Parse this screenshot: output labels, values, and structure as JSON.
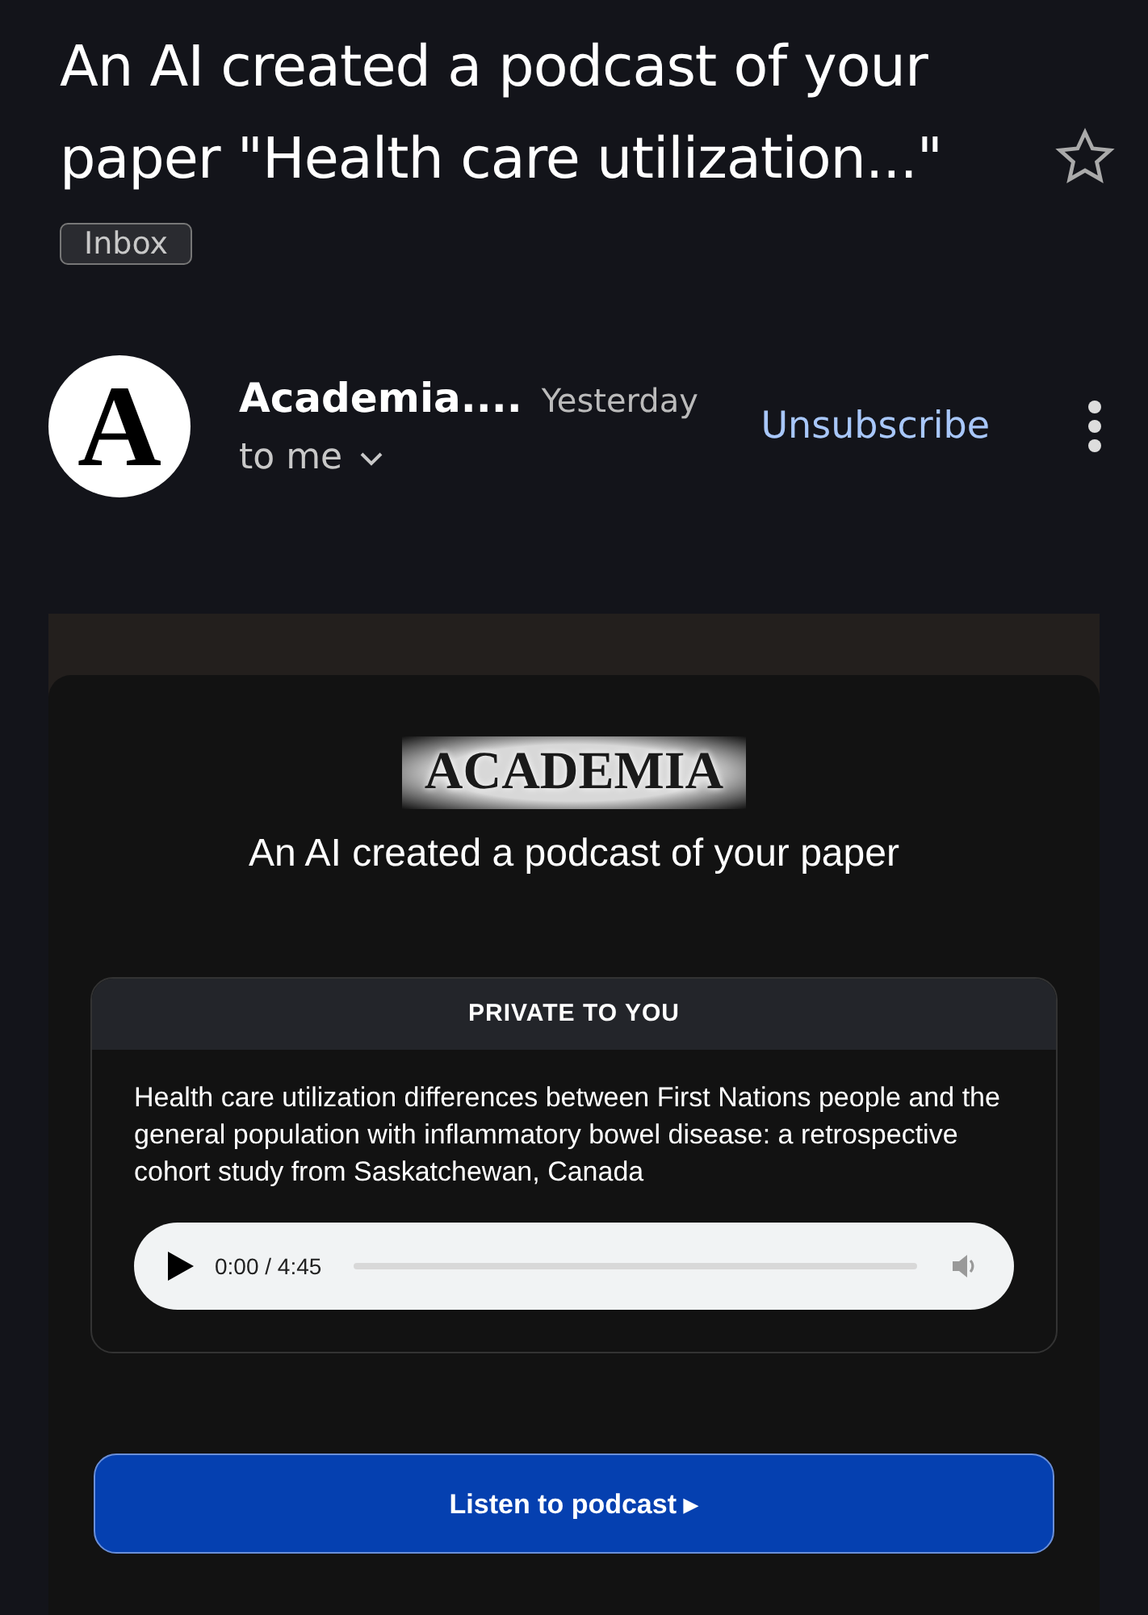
{
  "subject": {
    "title": "An AI created a podcast of your paper \"Health care utilization...\"",
    "starred": false,
    "label": "Inbox"
  },
  "sender": {
    "avatar_letter": "A",
    "name": "Academia....",
    "time": "Yesterday",
    "recipient": "to me",
    "unsubscribe": "Unsubscribe"
  },
  "body": {
    "logo": "ACADEMIA",
    "heading": "An AI created a podcast of your paper",
    "private_box": {
      "header": "PRIVATE TO YOU",
      "paper_title": "Health care utilization differences between First Nations people and the general population with inflammatory bowel disease: a retrospective cohort study from Saskatchewan, Canada",
      "player": {
        "time": "0:00 / 4:45",
        "level": 0
      }
    },
    "button": "Listen to podcast ▸"
  }
}
